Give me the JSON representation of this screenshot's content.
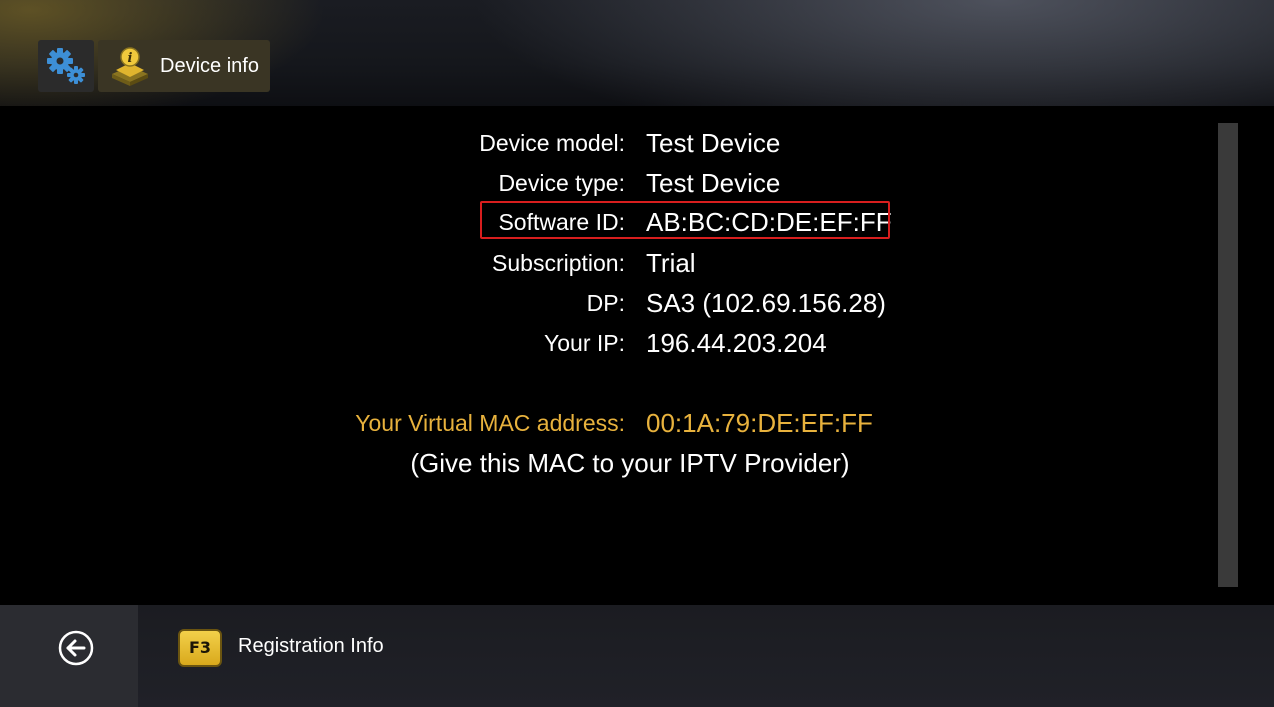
{
  "header": {
    "settings_icon": "gears-icon",
    "tab_icon": "device-info-icon",
    "tab_label": "Device info"
  },
  "device_info": {
    "rows": [
      {
        "label": "Device model:",
        "value": "Test Device"
      },
      {
        "label": "Device type:",
        "value": "Test Device"
      },
      {
        "label": "Software ID:",
        "value": "AB:BC:CD:DE:EF:FF"
      },
      {
        "label": "Subscription:",
        "value": "Trial"
      },
      {
        "label": "DP:",
        "value": "SA3 (102.69.156.28)"
      },
      {
        "label": "Your IP:",
        "value": "196.44.203.204"
      }
    ],
    "mac": {
      "label": "Your Virtual MAC address:",
      "value": "00:1A:79:DE:EF:FF"
    },
    "mac_note": "(Give this MAC to your IPTV Provider)"
  },
  "footer": {
    "back_icon": "back-arrow-icon",
    "f3_key": "F3",
    "f3_label": "Registration Info"
  },
  "colors": {
    "accent_gold": "#e8b23d",
    "highlight_red": "#d81e1e",
    "background": "#000000"
  }
}
